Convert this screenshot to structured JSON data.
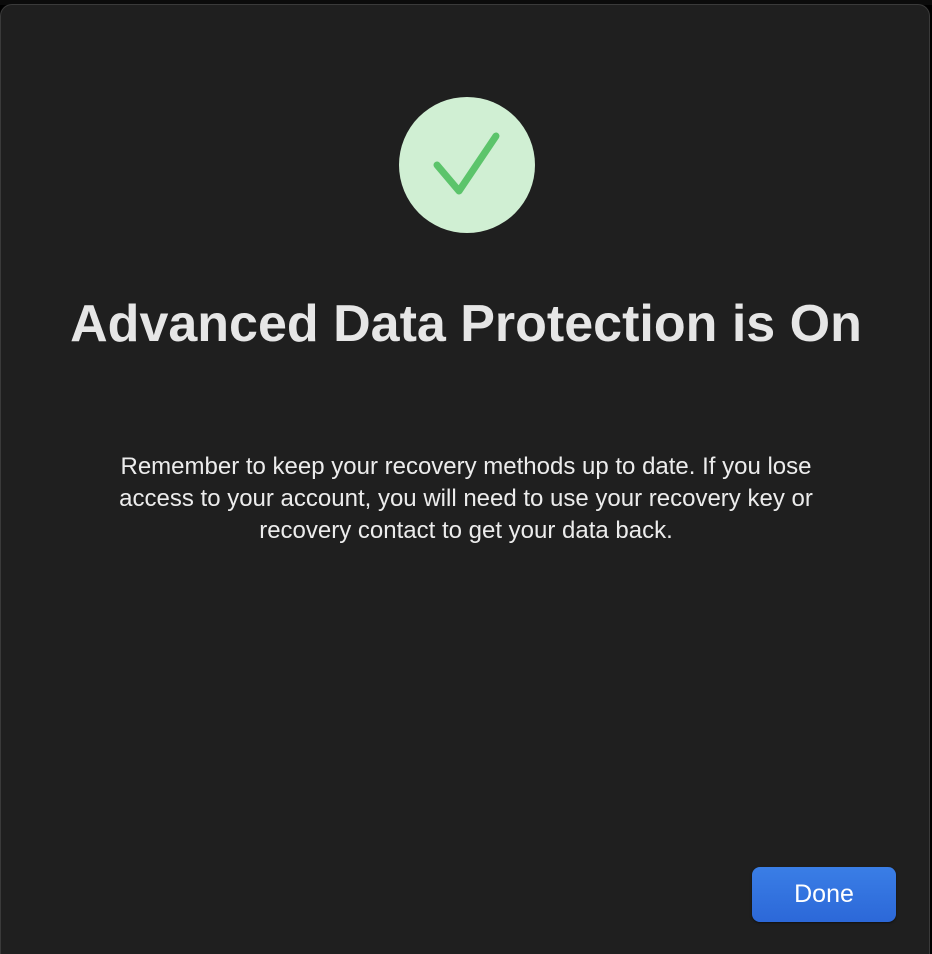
{
  "dialog": {
    "title": "Advanced Data Protection is On",
    "message": "Remember to keep your recovery methods up to date. If you lose access to your account, you will need to use your recovery key or recovery contact to get your data back.",
    "status_icon": "checkmark-icon",
    "done_label": "Done"
  },
  "colors": {
    "background": "#1f1f1f",
    "badge_fill": "#d0efd3",
    "checkmark": "#5cc46b",
    "button_accent": "#2f6fe0",
    "title_text": "#e6e6e6"
  }
}
